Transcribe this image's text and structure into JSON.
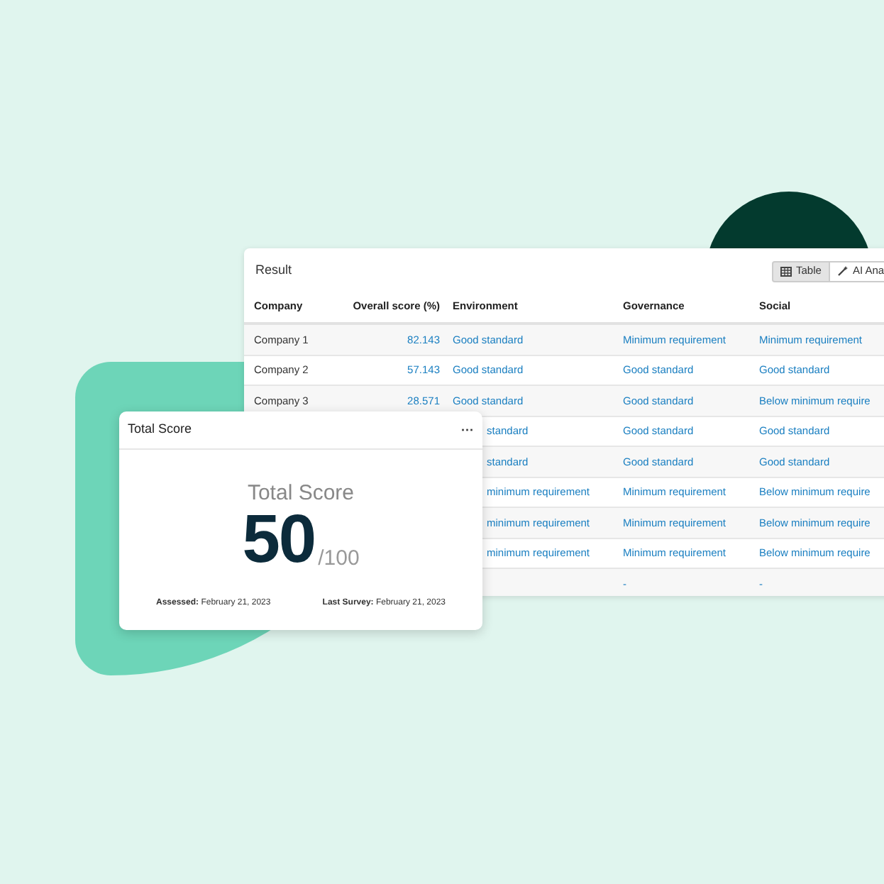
{
  "result_table": {
    "title": "Result",
    "view_tabs": [
      {
        "label": "Table",
        "selected": true
      },
      {
        "label": "AI Ana",
        "selected": false
      }
    ],
    "columns": [
      "Company",
      "Overall score (%)",
      "Environment",
      "Governance",
      "Social"
    ],
    "rows": [
      {
        "cells": [
          {
            "text": "Company 1"
          },
          {
            "text": "82.143"
          },
          {
            "text": "Good standard"
          },
          {
            "text": "Minimum requirement"
          },
          {
            "text": "Minimum requirement"
          }
        ]
      },
      {
        "cells": [
          {
            "text": "Company 2"
          },
          {
            "text": "57.143"
          },
          {
            "text": "Good standard"
          },
          {
            "text": "Good standard"
          },
          {
            "text": "Good standard"
          }
        ]
      },
      {
        "cells": [
          {
            "text": "Company 3"
          },
          {
            "text": "28.571"
          },
          {
            "text": "Good standard"
          },
          {
            "text": "Good standard"
          },
          {
            "text": "Below minimum require"
          }
        ]
      },
      {
        "cells": [
          null,
          null,
          {
            "text": "standard",
            "clipped": true
          },
          {
            "text": "Good standard"
          },
          {
            "text": "Good standard"
          }
        ]
      },
      {
        "cells": [
          null,
          null,
          {
            "text": "standard",
            "clipped": true
          },
          {
            "text": "Good standard"
          },
          {
            "text": "Good standard"
          }
        ]
      },
      {
        "cells": [
          null,
          null,
          {
            "text": "minimum requirement",
            "clipped": true
          },
          {
            "text": "Minimum requirement"
          },
          {
            "text": "Below minimum require"
          }
        ]
      },
      {
        "cells": [
          null,
          null,
          {
            "text": "minimum requirement",
            "clipped": true
          },
          {
            "text": "Minimum requirement"
          },
          {
            "text": "Below minimum require"
          }
        ]
      },
      {
        "cells": [
          null,
          null,
          {
            "text": "minimum requirement",
            "clipped": true
          },
          {
            "text": "Minimum requirement"
          },
          {
            "text": "Below minimum require"
          }
        ]
      },
      {
        "cells": [
          null,
          null,
          null,
          {
            "text": "-"
          },
          {
            "text": "-"
          }
        ]
      }
    ]
  },
  "score_card": {
    "title": "Total Score",
    "menu": "···",
    "heading": "Total Score",
    "score": "50",
    "max": "/100",
    "footer": [
      {
        "label": "Assessed:",
        "value": "February 21, 2023"
      },
      {
        "label": "Last Survey:",
        "value": "February 21, 2023"
      }
    ]
  }
}
